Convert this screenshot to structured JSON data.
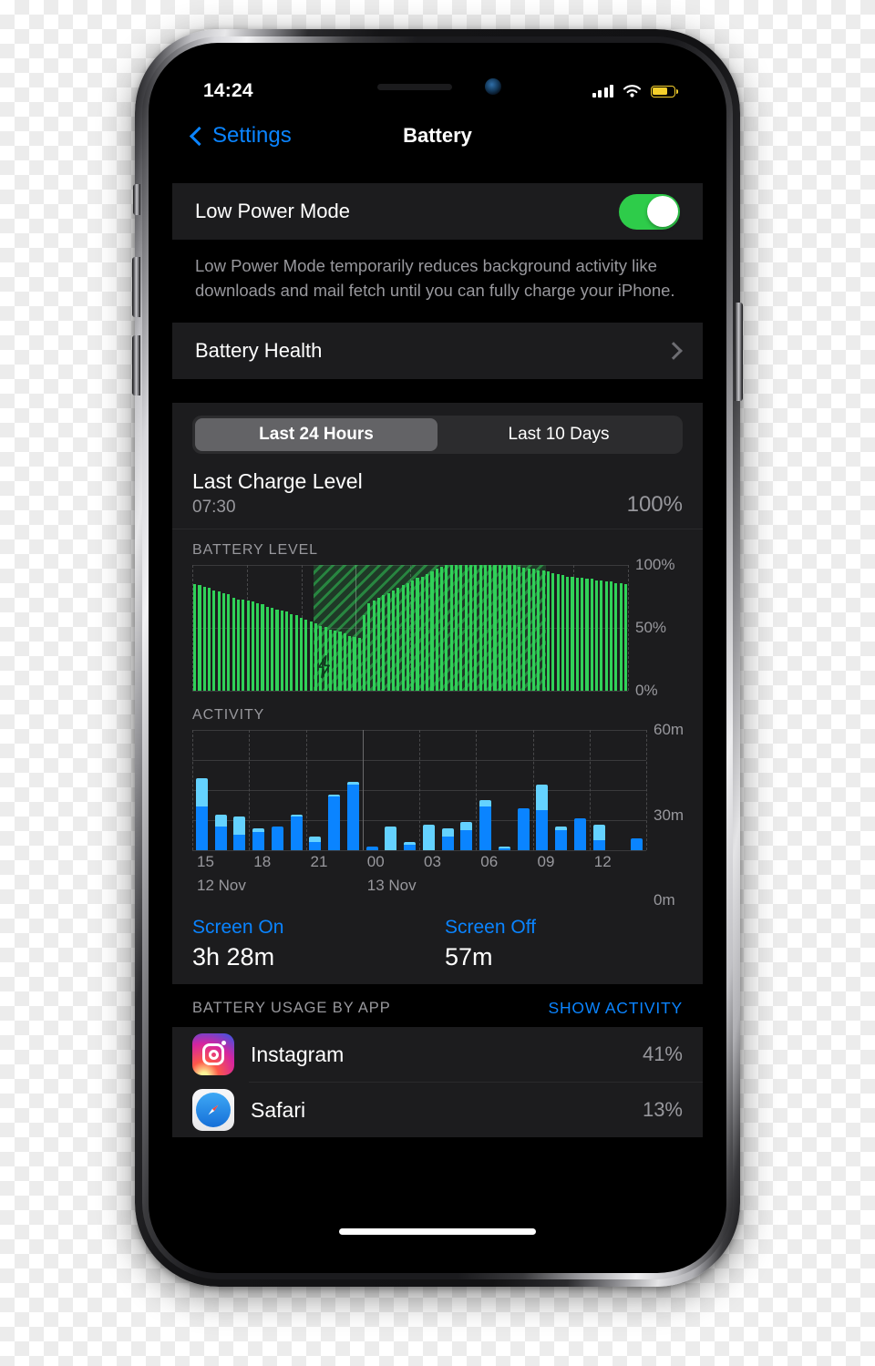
{
  "status_bar": {
    "time": "14:24",
    "signal_icon": "cellular-signal-icon",
    "wifi_icon": "wifi-icon",
    "battery_icon": "battery-icon",
    "battery_color": "#f5cf2b",
    "battery_fill_percent": 70
  },
  "nav": {
    "back_label": "Settings",
    "title": "Battery"
  },
  "low_power": {
    "label": "Low Power Mode",
    "toggle_state": "on",
    "toggle_color": "#2ecc4a",
    "footnote": "Low Power Mode temporarily reduces background activity like downloads and mail fetch until you can fully charge your iPhone."
  },
  "battery_health": {
    "label": "Battery Health"
  },
  "segmented": {
    "options": [
      "Last 24 Hours",
      "Last 10 Days"
    ],
    "selected_index": 0
  },
  "last_charge": {
    "title": "Last Charge Level",
    "time": "07:30",
    "percent": "100%"
  },
  "screen_time": {
    "on_label": "Screen On",
    "on_value": "3h 28m",
    "off_label": "Screen Off",
    "off_value": "57m"
  },
  "usage_header": {
    "left": "BATTERY USAGE BY APP",
    "right": "SHOW ACTIVITY"
  },
  "apps": [
    {
      "name": "Instagram",
      "percent": "41%",
      "icon": "instagram-icon"
    },
    {
      "name": "Safari",
      "percent": "13%",
      "icon": "safari-icon"
    }
  ],
  "chart_data": [
    {
      "type": "bar",
      "title": "BATTERY LEVEL",
      "ylabel": "",
      "xlabel": "",
      "ylim": [
        0,
        100
      ],
      "ytick_labels": [
        "100%",
        "50%",
        "0%"
      ],
      "ytick_values": [
        100,
        50,
        0
      ],
      "bar_color": "#30d158",
      "charging_band": {
        "start_index": 25,
        "end_index": 72,
        "pattern": "diagonal-hatch",
        "icon": "charging-bolt-icon"
      },
      "grid": true,
      "x": [
        "15:00",
        "15:20",
        "15:40",
        "16:00",
        "16:20",
        "16:40",
        "17:00",
        "17:20",
        "17:40",
        "18:00",
        "18:20",
        "18:40",
        "19:00",
        "19:20",
        "19:40",
        "20:00",
        "20:20",
        "20:40",
        "21:00",
        "21:20",
        "21:40",
        "22:00",
        "22:20",
        "22:40",
        "23:00",
        "23:20",
        "23:40",
        "00:00",
        "00:20",
        "00:40",
        "01:00",
        "01:20",
        "01:40",
        "02:00",
        "02:20",
        "02:40",
        "03:00",
        "03:20",
        "03:40",
        "04:00",
        "04:20",
        "04:40",
        "05:00",
        "05:20",
        "05:40",
        "06:00",
        "06:20",
        "06:40",
        "07:00",
        "07:20",
        "07:40",
        "08:00",
        "08:20",
        "08:40",
        "09:00",
        "09:20",
        "09:40",
        "10:00",
        "10:20",
        "10:40",
        "11:00",
        "11:20",
        "11:40",
        "12:00",
        "12:20",
        "12:40",
        "13:00",
        "13:20",
        "13:40",
        "14:00",
        "14:20",
        "14:24"
      ],
      "values": [
        85,
        84,
        83,
        82,
        80,
        79,
        78,
        77,
        74,
        73,
        73,
        72,
        71,
        70,
        69,
        67,
        66,
        65,
        64,
        63,
        61,
        60,
        58,
        57,
        55,
        54,
        52,
        51,
        49,
        48,
        47,
        46,
        44,
        43,
        42,
        60,
        70,
        72,
        74,
        76,
        78,
        80,
        82,
        84,
        86,
        88,
        90,
        91,
        93,
        95,
        97,
        99,
        100,
        100,
        100,
        100,
        100,
        100,
        100,
        100,
        100,
        100,
        100,
        100,
        100,
        100,
        100,
        99,
        98,
        97,
        97,
        96,
        96,
        95,
        94,
        93,
        92,
        91,
        91,
        90,
        90,
        89,
        89,
        88,
        88,
        87,
        87,
        86,
        86,
        85
      ]
    },
    {
      "type": "bar",
      "stacked": true,
      "title": "ACTIVITY",
      "ylim": [
        0,
        60
      ],
      "ytick_labels": [
        "60m",
        "30m",
        "0m"
      ],
      "ytick_values": [
        60,
        30,
        0
      ],
      "xtick_labels": [
        "15",
        "18",
        "21",
        "00",
        "03",
        "06",
        "09",
        "12"
      ],
      "date_labels": [
        "12 Nov",
        "13 Nov"
      ],
      "grid": true,
      "legend": [
        {
          "name": "Screen On",
          "color": "#0a84ff"
        },
        {
          "name": "Screen Off",
          "color": "#64d2ff"
        }
      ],
      "categories": [
        "15",
        "16",
        "17",
        "18",
        "19",
        "20",
        "21",
        "22",
        "23",
        "00",
        "01",
        "02",
        "03",
        "04",
        "05",
        "06",
        "07",
        "08",
        "09",
        "10",
        "11",
        "12",
        "13",
        "14"
      ],
      "series": [
        {
          "name": "Screen On",
          "color": "#0a84ff",
          "values": [
            22,
            12,
            8,
            9,
            12,
            17,
            4,
            27,
            33,
            2,
            0,
            3,
            0,
            7,
            10,
            22,
            1,
            21,
            20,
            10,
            16,
            5,
            0,
            6
          ]
        },
        {
          "name": "Screen Off",
          "color": "#64d2ff",
          "values": [
            14,
            6,
            9,
            2,
            0,
            1,
            3,
            1,
            1,
            0,
            12,
            1,
            13,
            4,
            4,
            3,
            1,
            0,
            13,
            2,
            0,
            8,
            0,
            0
          ]
        }
      ]
    }
  ]
}
